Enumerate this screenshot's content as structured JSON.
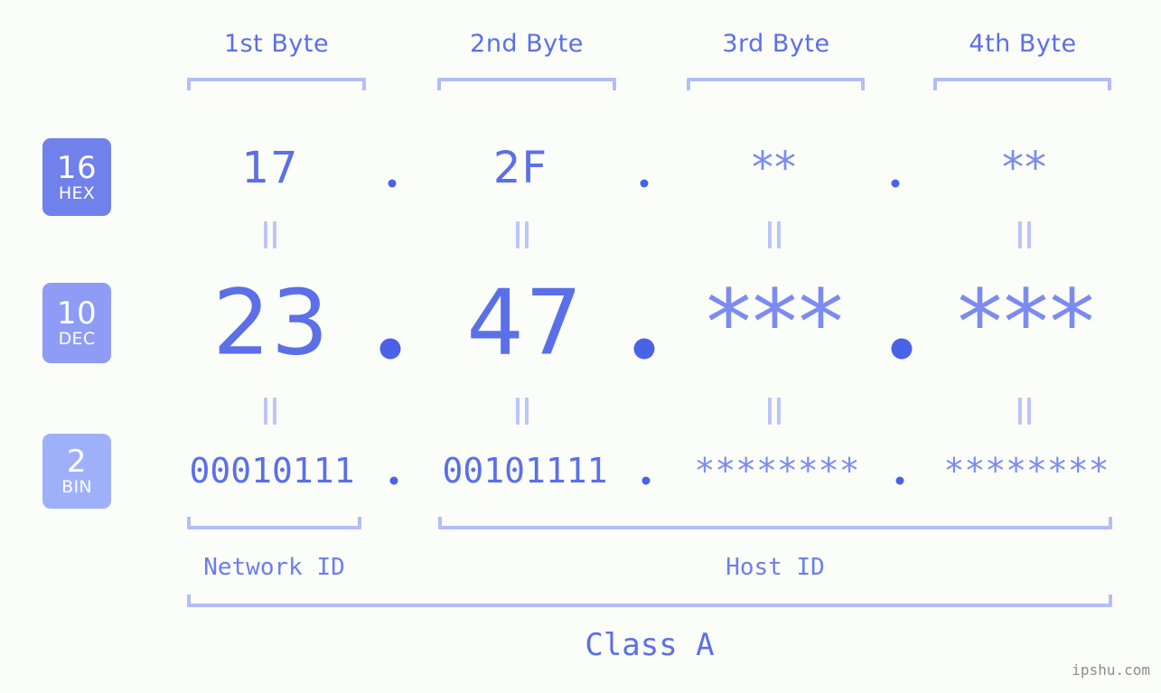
{
  "page": {
    "background_color": "#fbfdf8",
    "accent_color": "#5b6fe8",
    "bracket_color": "#b3bdfb",
    "watermark": "ipshu.com"
  },
  "byte_headers": [
    {
      "label": "1st Byte"
    },
    {
      "label": "2nd Byte"
    },
    {
      "label": "3rd Byte"
    },
    {
      "label": "4th Byte"
    }
  ],
  "bases": [
    {
      "num": "16",
      "label": "HEX",
      "color": "#7081ec"
    },
    {
      "num": "10",
      "label": "DEC",
      "color": "#8e9cf5"
    },
    {
      "num": "2",
      "label": "BIN",
      "color": "#9fb0fb"
    }
  ],
  "rows": {
    "hex": {
      "values": [
        "17",
        "2F",
        "**",
        "**"
      ],
      "separator": "."
    },
    "dec": {
      "values": [
        "23",
        "47",
        "***",
        "***"
      ],
      "separator": "."
    },
    "bin": {
      "values": [
        "00010111",
        "00101111",
        "********",
        "********"
      ],
      "separator": "."
    }
  },
  "connectors": {
    "symbol": "="
  },
  "id_sections": [
    {
      "label": "Network ID"
    },
    {
      "label": "Host ID"
    }
  ],
  "class_label": "Class A"
}
